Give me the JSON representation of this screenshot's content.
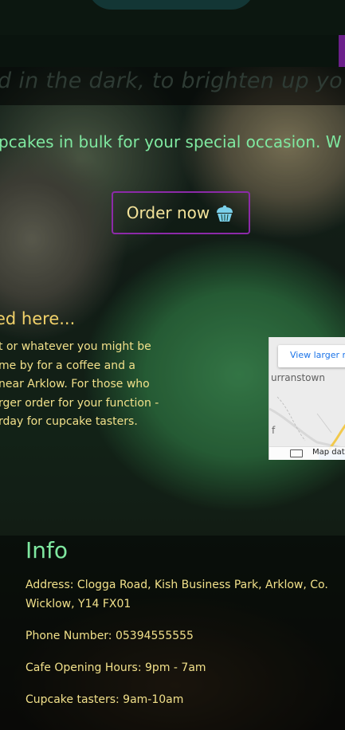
{
  "header": {
    "tagline": "d in the dark, to brighten up yo"
  },
  "hero": {
    "bulk_text": "pcakes in bulk for your special occasion. W",
    "order_button_label": "Order now"
  },
  "location": {
    "heading": "ed here...",
    "paragraph_lines": [
      "t or whatever you might be",
      "me by for a coffee and a",
      " near Arklow. For those who",
      "rger order for your function -",
      "rday for cupcake tasters."
    ]
  },
  "map": {
    "link_text": "View larger m",
    "town_label": "urranstown",
    "side_letter": "f",
    "data_label": "Map data"
  },
  "info": {
    "title": "Info",
    "address": "Address: Clogga Road, Kish Business Park, Arklow, Co. Wicklow, Y14 FX01",
    "phone": "Phone Number: 05394555555",
    "hours": "Cafe Opening Hours: 9pm - 7am",
    "tasters": "Cupcake tasters: 9am-10am"
  },
  "colors": {
    "accent_green": "#7fe8a0",
    "text_yellow": "#f1e08a",
    "button_border_purple": "#8c2aa8"
  }
}
